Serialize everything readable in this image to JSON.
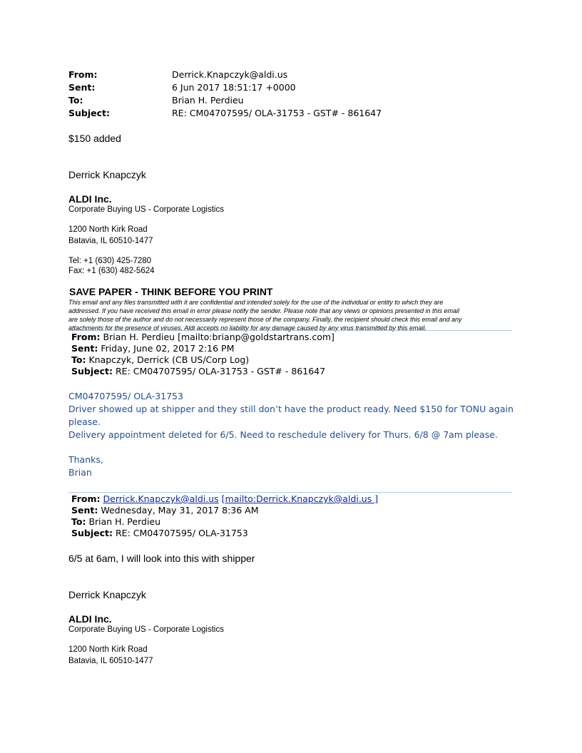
{
  "header": {
    "from_label": "From:",
    "from_value": "Derrick.Knapczyk@aldi.us",
    "sent_label": "Sent:",
    "sent_value": "6 Jun 2017 18:51:17 +0000",
    "to_label": "To:",
    "to_value": "Brian H. Perdieu",
    "subject_label": "Subject:",
    "subject_value": "RE: CM04707595/  OLA-31753  - GST# - 861647"
  },
  "message1": {
    "body": "$150 added",
    "signature_name": "Derrick Knapczyk",
    "company": "ALDI Inc.",
    "department": "Corporate Buying US - Corporate Logistics",
    "address_line1": "1200 North Kirk Road",
    "address_line2": "Batavia, IL 60510-1477",
    "tel": "Tel:  +1 (630) 425-7280",
    "fax": "Fax: +1 (630) 482-5624",
    "save_paper": "SAVE  PAPER - THINK BEFORE YOU PRINT",
    "disclaimer_lines": [
      "This email and any files transmitted with it are confidential and intended solely for the use of the individual or entity to which they are",
      "addressed. If you have received this email in error please notify the sender. Please note that any views or opinions presented in this email",
      "are solely those of the author and do not necessarily represent those of the company. Finally, the recipient should check this email and any",
      "attachments for the presence of viruses. Aldi accepts no liability for any damage caused by any virus transmitted by this email."
    ]
  },
  "forward1": {
    "from_label": "From:",
    "from_value": "Brian H. Perdieu [mailto:brianp@goldstartrans.com]",
    "sent_label": "Sent:",
    "sent_value": "Friday, June 02, 2017 2:16 PM",
    "to_label": "To:",
    "to_value": "Knapczyk,  Derrick  (CB US/Corp Log)",
    "subject_label": "Subject:",
    "subject_value": "RE: CM04707595/  OLA-31753  - GST# - 861647",
    "body_lines": [
      "CM04707595/  OLA-31753",
      "Driver showed up at shipper and they still don’t have the product ready.  Need $150  for TONU again",
      "please.",
      "Delivery appointment deleted for 6/5.  Need to reschedule delivery for Thurs. 6/8 @ 7am please.",
      "Thanks,",
      "Brian"
    ]
  },
  "forward2": {
    "from_label": "From:",
    "from_link": "Derrick.Knapczyk@aldi.us",
    "from_mailto": "[mailto:Derrick.Knapczyk@aldi.us ]",
    "sent_label": "Sent:",
    "sent_value": "Wednesday, May 31, 2017 8:36 AM",
    "to_label": "To:",
    "to_value": "Brian H. Perdieu",
    "subject_label": "Subject:",
    "subject_value": "RE: CM04707595/  OLA-31753",
    "body": "6/5 at 6am, I will look into this with shipper",
    "signature_name": "Derrick Knapczyk",
    "company": "ALDI Inc.",
    "department": "Corporate Buying US - Corporate Logistics",
    "address_line1": "1200 North Kirk Road",
    "address_line2": "Batavia, IL 60510-1477"
  }
}
